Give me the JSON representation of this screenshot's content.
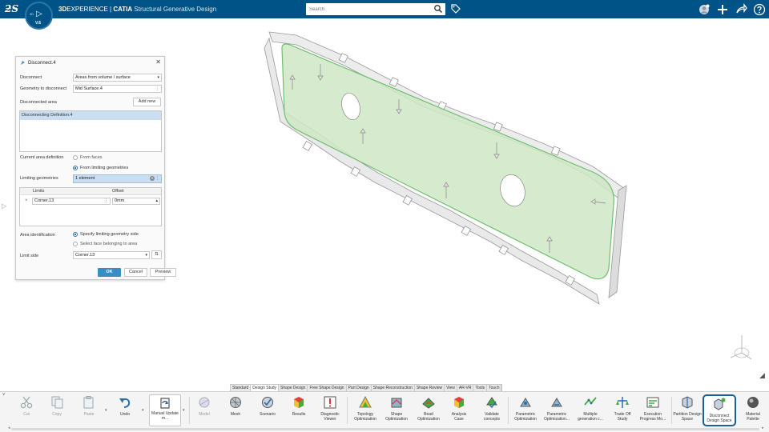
{
  "topbar": {
    "brand_bold": "3D",
    "brand_rest": "EXPERIENCE | ",
    "product": "CATIA",
    "app_name": "Structural Generative Design",
    "compass_version": "V.6",
    "compass_3d": "3D",
    "search_placeholder": "Search",
    "icons": [
      "user-avatar-icon",
      "plus-icon",
      "share-icon",
      "help-icon"
    ]
  },
  "dialog": {
    "title": "Disconnect.4",
    "disconnect_label": "Disconnect",
    "disconnect_value": "Areas from volume / surface",
    "geometry_label": "Geometry to disconnect",
    "geometry_value": "Mid Surface.4",
    "disconnected_area_label": "Disconnected area",
    "add_new": "Add new",
    "list_items": [
      "Disconnecting Definition.4"
    ],
    "current_area_label": "Current area definition",
    "from_faces": "From faces",
    "from_limiting": "From limiting geometries",
    "limiting_label": "Limiting geometries",
    "limiting_value": "1 element",
    "table_headers": [
      "Limits",
      "Offset"
    ],
    "table_rows": [
      {
        "limit": "Corner.13",
        "offset": "0mm"
      }
    ],
    "area_id_label": "Area identification",
    "specify_side": "Specify limiting geometry side",
    "select_face": "Select face belonging to area",
    "limit_side_label": "Limit side",
    "limit_side_value": "Corner.13",
    "ok": "OK",
    "cancel": "Cancel",
    "preview": "Preview"
  },
  "workbench_tabs": [
    "Standard",
    "Design Study",
    "Shape Design",
    "Free Shape Design",
    "Part Design",
    "Shape Reconstruction",
    "Shape Review",
    "View",
    "AR-VR",
    "Tools",
    "Touch"
  ],
  "active_tab": "Design Study",
  "actions": [
    {
      "label": "Cut",
      "icon": "scissors-icon"
    },
    {
      "label": "Copy",
      "icon": "copy-icon"
    },
    {
      "label": "Paste",
      "icon": "paste-icon"
    },
    {
      "label": "Undo",
      "icon": "undo-icon"
    },
    {
      "label": "Manual Update m...",
      "icon": "manual-update-icon"
    },
    {
      "label": "Model",
      "icon": "model-icon"
    },
    {
      "label": "Mesh",
      "icon": "mesh-icon"
    },
    {
      "label": "Scenario",
      "icon": "scenario-icon"
    },
    {
      "label": "Results",
      "icon": "results-icon"
    },
    {
      "label": "Diagnostic Viewer",
      "icon": "diagnostic-viewer-icon"
    },
    {
      "label": "Topology Optimization",
      "icon": "topology-optimization-icon"
    },
    {
      "label": "Shape Optimization",
      "icon": "shape-optimization-icon"
    },
    {
      "label": "Bead Optimization",
      "icon": "bead-optimization-icon"
    },
    {
      "label": "Analysis Case",
      "icon": "analysis-case-icon"
    },
    {
      "label": "Validate concepts",
      "icon": "validate-concepts-icon"
    },
    {
      "label": "Parametric Optimization",
      "icon": "parametric-optimization-icon"
    },
    {
      "label": "Parametric Optimization...",
      "icon": "parametric-optimization-2-icon"
    },
    {
      "label": "Multiple generation c...",
      "icon": "multiple-generation-icon"
    },
    {
      "label": "Trade Off Study",
      "icon": "trade-off-study-icon"
    },
    {
      "label": "Execution Progress Mo...",
      "icon": "execution-progress-icon"
    },
    {
      "label": "Partition Design Space",
      "icon": "partition-design-space-icon"
    },
    {
      "label": "Disconnect Design Space",
      "icon": "disconnect-design-space-icon"
    },
    {
      "label": "Material Palette",
      "icon": "material-palette-icon"
    }
  ]
}
